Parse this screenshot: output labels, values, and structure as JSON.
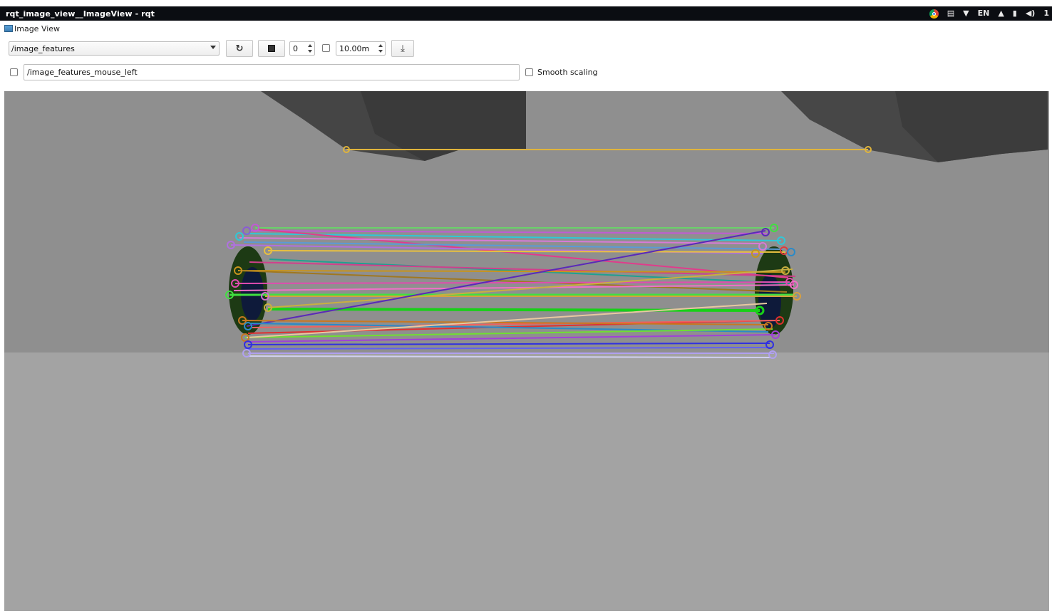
{
  "window": {
    "title": "rqt_image_view__ImageView - rqt"
  },
  "tray": {
    "icons": [
      "chrome-icon",
      "network-icon",
      "wifi-icon",
      "keyboard-layout",
      "notification-bell-icon",
      "battery-icon",
      "volume-icon"
    ],
    "keyboard_layout": "EN",
    "clock_partial": "1"
  },
  "plugin": {
    "title": "Image View"
  },
  "toolbar": {
    "topic_selected": "/image_features",
    "refresh_symbol": "↻",
    "zoom_value": "0",
    "rotation_value": "10.00m",
    "save_symbol": "⤓",
    "mouse_topic_value": "/image_features_mouse_left",
    "smooth_scaling_label": "Smooth scaling"
  },
  "scene": {
    "sky_color": "#7a7a7a",
    "wall_color": "#8f8f8f",
    "ground_color": "#a3a3a3",
    "dark_shape_color": "#3e3e3e",
    "highlight_line_color": "#e0b43c"
  }
}
